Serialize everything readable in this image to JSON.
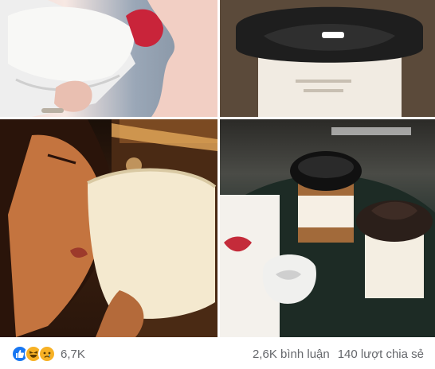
{
  "post": {
    "images": [
      {
        "name": "cup-lips-closeup"
      },
      {
        "name": "lips-lid-cup"
      },
      {
        "name": "woman-drinking-lip-cup"
      },
      {
        "name": "lip-lid-cups-on-table"
      }
    ]
  },
  "reactions": {
    "icons": [
      "like-icon",
      "haha-icon",
      "sad-icon"
    ],
    "count": "6,7K"
  },
  "stats": {
    "comments": "2,6K bình luận",
    "shares": "140 lượt chia sẻ"
  },
  "colors": {
    "like": "#1877f2",
    "emoji": "#f7b125",
    "muted": "#65676b"
  }
}
